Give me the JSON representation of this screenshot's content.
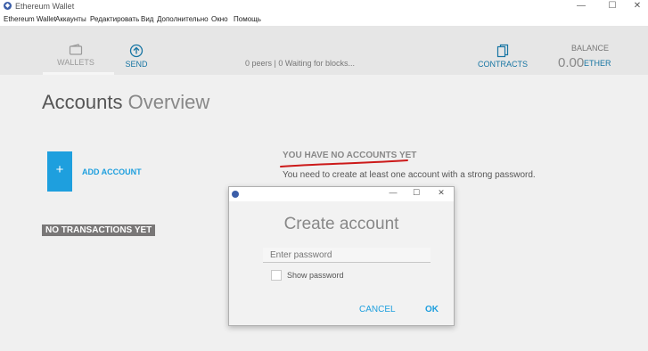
{
  "window": {
    "title": "Ethereum Wallet",
    "minimize": "—",
    "maximize": "☐",
    "close": "✕"
  },
  "menu": [
    "Ethereum Wallet",
    "Аккаунты",
    "Редактировать",
    "Вид",
    "Дополнительно",
    "Окно",
    "Помощь"
  ],
  "header": {
    "wallets_label": "WALLETS",
    "send_label": "SEND",
    "status": "0 peers  |  0  Waiting for blocks...",
    "contracts_label": "CONTRACTS",
    "balance_label": "BALANCE",
    "balance_amount": "0.00",
    "balance_unit": "ETHER"
  },
  "main": {
    "title_strong": "Accounts",
    "title_light": "Overview",
    "add_symbol": "+",
    "add_account_label": "ADD ACCOUNT",
    "no_transactions": "NO TRANSACTIONS YET",
    "no_accounts": "YOU HAVE NO ACCOUNTS YET",
    "need_create": "You need to create at least one account with a strong password."
  },
  "dialog": {
    "title": "Create account",
    "password_placeholder": "Enter password",
    "show_password": "Show password",
    "cancel": "CANCEL",
    "ok": "OK",
    "minimize": "—",
    "maximize": "☐",
    "close": "✕"
  },
  "colors": {
    "accent": "#1e9fde",
    "link": "#1775a3",
    "annotation": "#cc1a1a"
  }
}
